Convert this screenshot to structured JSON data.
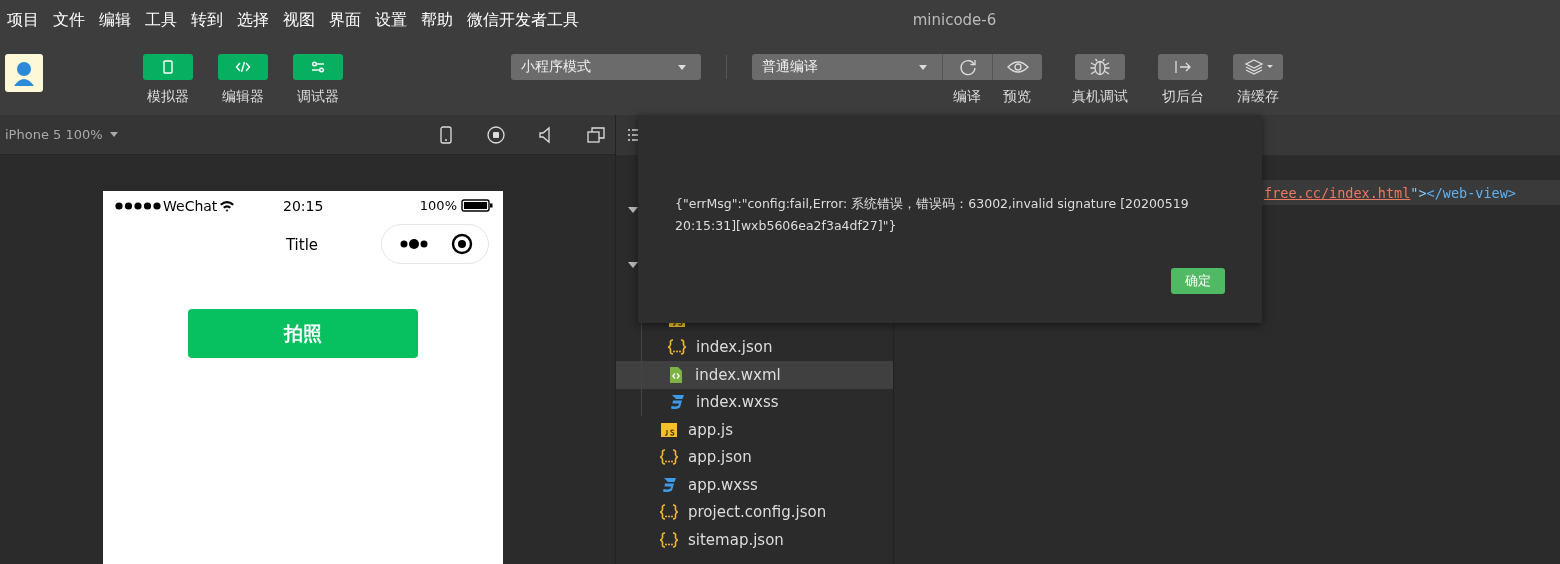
{
  "menu_bar": {
    "items": [
      "项目",
      "文件",
      "编辑",
      "工具",
      "转到",
      "选择",
      "视图",
      "界面",
      "设置",
      "帮助",
      "微信开发者工具"
    ],
    "title": "minicode-6"
  },
  "toolbar": {
    "view_buttons": [
      {
        "kind": "simulator",
        "label": "模拟器"
      },
      {
        "kind": "editor",
        "label": "编辑器"
      },
      {
        "kind": "debugger",
        "label": "调试器"
      }
    ],
    "mode_select": {
      "value": "小程序模式"
    },
    "compile_select": {
      "value": "普通编译"
    },
    "actions": [
      {
        "kind": "compile",
        "label": "编译"
      },
      {
        "kind": "preview",
        "label": "预览"
      },
      {
        "kind": "debug",
        "label": "真机调试"
      },
      {
        "kind": "background",
        "label": "切后台"
      },
      {
        "kind": "cache",
        "label": "清缓存"
      }
    ]
  },
  "simulator": {
    "device": "iPhone 5 100%",
    "status_bar": {
      "carrier": "WeChat",
      "time": "20:15",
      "battery": "100%"
    },
    "nav_title": "Title",
    "button": "拍照"
  },
  "file_tree": [
    {
      "kind": "folder",
      "expanded": true
    },
    {
      "kind": "folder",
      "expanded": true,
      "children": [
        {
          "kind": "js",
          "selected": false
        },
        {
          "kind": "json",
          "name": "index.json",
          "selected": false
        },
        {
          "kind": "wxml",
          "name": "index.wxml",
          "selected": true
        },
        {
          "kind": "wxss",
          "name": "index.wxss",
          "selected": false
        }
      ]
    },
    {
      "kind": "js",
      "name": "app.js",
      "selected": false
    },
    {
      "kind": "json",
      "name": "app.json",
      "selected": false
    },
    {
      "kind": "wxss",
      "name": "app.wxss",
      "selected": false
    },
    {
      "kind": "json",
      "name": "project.config.json",
      "selected": false
    },
    {
      "kind": "json",
      "name": "sitemap.json",
      "selected": false
    }
  ],
  "editor": {
    "line": [
      {
        "kind": "link",
        "text": "free.cc/index.html"
      },
      {
        "kind": "punct",
        "text": "\">"
      },
      {
        "kind": "tag",
        "text": "</web-view>"
      }
    ]
  },
  "dialog": {
    "message": "{\"errMsg\":\"config:fail,Error: 系统错误，错误码：63002,invalid signature [20200519 20:15:31][wxb5606ea2f3a4df27]\"}",
    "button": "确定"
  }
}
